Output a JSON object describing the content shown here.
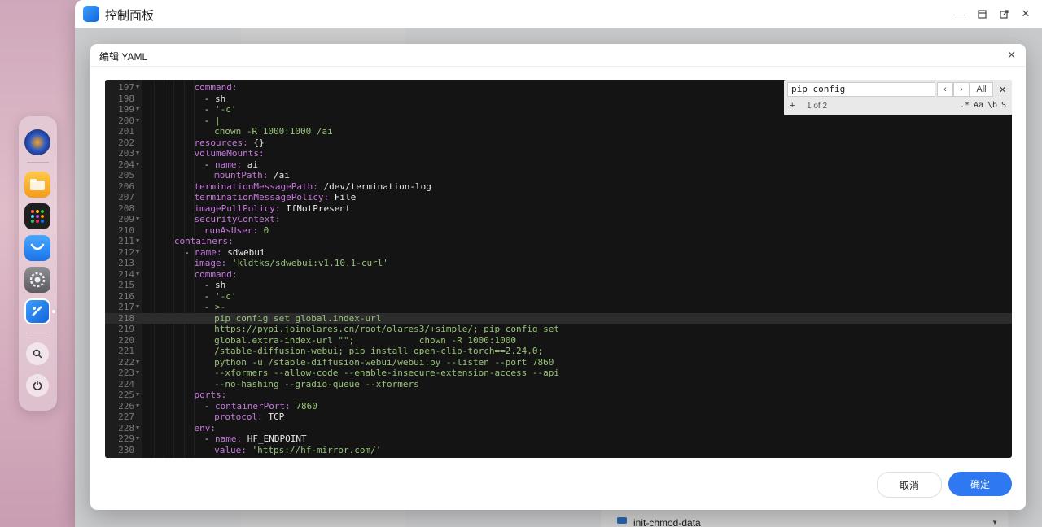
{
  "window": {
    "title": "控制面板"
  },
  "background": {
    "bottom_item": "init-chmod-data"
  },
  "dialog": {
    "title": "编辑 YAML",
    "cancel_label": "取消",
    "ok_label": "确定"
  },
  "search": {
    "query": "pip config",
    "all_label": "All",
    "count": "1 of 2",
    "prev": "‹",
    "next": "›",
    "close": "✕",
    "plus": "+",
    "opt_regex": ".*",
    "opt_case": "Aa",
    "opt_word": "\\b",
    "opt_selection": "S"
  },
  "editor": {
    "lines": [
      {
        "n": "197",
        "fold": true,
        "indent": 5,
        "parts": [
          [
            "k",
            "command"
          ],
          [
            "k",
            ":"
          ]
        ]
      },
      {
        "n": "198",
        "fold": false,
        "indent": 6,
        "parts": [
          [
            "n",
            "- "
          ],
          [
            "n",
            "sh"
          ]
        ]
      },
      {
        "n": "199",
        "fold": true,
        "indent": 6,
        "parts": [
          [
            "n",
            "- "
          ],
          [
            "s",
            "'-c'"
          ]
        ]
      },
      {
        "n": "200",
        "fold": true,
        "indent": 6,
        "parts": [
          [
            "n",
            "- "
          ],
          [
            "s",
            "|"
          ]
        ]
      },
      {
        "n": "201",
        "fold": false,
        "indent": 7,
        "parts": [
          [
            "s",
            "chown -R 1000:1000 /ai"
          ]
        ]
      },
      {
        "n": "202",
        "fold": false,
        "indent": 5,
        "parts": [
          [
            "k",
            "resources"
          ],
          [
            "k",
            ": "
          ],
          [
            "n",
            "{}"
          ]
        ]
      },
      {
        "n": "203",
        "fold": true,
        "indent": 5,
        "parts": [
          [
            "k",
            "volumeMounts"
          ],
          [
            "k",
            ":"
          ]
        ]
      },
      {
        "n": "204",
        "fold": true,
        "indent": 6,
        "parts": [
          [
            "n",
            "- "
          ],
          [
            "k",
            "name"
          ],
          [
            "k",
            ": "
          ],
          [
            "n",
            "ai"
          ]
        ]
      },
      {
        "n": "205",
        "fold": false,
        "indent": 7,
        "parts": [
          [
            "k",
            "mountPath"
          ],
          [
            "k",
            ": "
          ],
          [
            "n",
            "/ai"
          ]
        ]
      },
      {
        "n": "206",
        "fold": false,
        "indent": 5,
        "parts": [
          [
            "k",
            "terminationMessagePath"
          ],
          [
            "k",
            ": "
          ],
          [
            "n",
            "/dev/termination-log"
          ]
        ]
      },
      {
        "n": "207",
        "fold": false,
        "indent": 5,
        "parts": [
          [
            "k",
            "terminationMessagePolicy"
          ],
          [
            "k",
            ": "
          ],
          [
            "n",
            "File"
          ]
        ]
      },
      {
        "n": "208",
        "fold": false,
        "indent": 5,
        "parts": [
          [
            "k",
            "imagePullPolicy"
          ],
          [
            "k",
            ": "
          ],
          [
            "n",
            "IfNotPresent"
          ]
        ]
      },
      {
        "n": "209",
        "fold": true,
        "indent": 5,
        "parts": [
          [
            "k",
            "securityContext"
          ],
          [
            "k",
            ":"
          ]
        ]
      },
      {
        "n": "210",
        "fold": false,
        "indent": 6,
        "parts": [
          [
            "k",
            "runAsUser"
          ],
          [
            "k",
            ": "
          ],
          [
            "s",
            "0"
          ]
        ]
      },
      {
        "n": "211",
        "fold": true,
        "indent": 3,
        "parts": [
          [
            "k",
            "containers"
          ],
          [
            "k",
            ":"
          ]
        ]
      },
      {
        "n": "212",
        "fold": true,
        "indent": 4,
        "parts": [
          [
            "n",
            "- "
          ],
          [
            "k",
            "name"
          ],
          [
            "k",
            ": "
          ],
          [
            "n",
            "sdwebui"
          ]
        ]
      },
      {
        "n": "213",
        "fold": false,
        "indent": 5,
        "parts": [
          [
            "k",
            "image"
          ],
          [
            "k",
            ": "
          ],
          [
            "s",
            "'kldtks/sdwebui:v1.10.1-curl'"
          ]
        ]
      },
      {
        "n": "214",
        "fold": true,
        "indent": 5,
        "parts": [
          [
            "k",
            "command"
          ],
          [
            "k",
            ":"
          ]
        ]
      },
      {
        "n": "215",
        "fold": false,
        "indent": 6,
        "parts": [
          [
            "n",
            "- "
          ],
          [
            "n",
            "sh"
          ]
        ]
      },
      {
        "n": "216",
        "fold": false,
        "indent": 6,
        "parts": [
          [
            "n",
            "- "
          ],
          [
            "s",
            "'-c'"
          ]
        ]
      },
      {
        "n": "217",
        "fold": true,
        "indent": 6,
        "parts": [
          [
            "n",
            "- "
          ],
          [
            "s",
            ">-"
          ]
        ]
      },
      {
        "n": "218",
        "fold": false,
        "indent": 7,
        "active": true,
        "parts": [
          [
            "s",
            "pip config"
          ],
          [
            "s",
            " set global.index-url"
          ]
        ]
      },
      {
        "n": "219",
        "fold": false,
        "indent": 7,
        "parts": [
          [
            "s",
            "https://pypi.joinolares.cn/root/olares3/+simple/; pip config set"
          ]
        ]
      },
      {
        "n": "220",
        "fold": false,
        "indent": 7,
        "parts": [
          [
            "s",
            "global.extra-index-url \"\";            chown -R 1000:1000"
          ]
        ]
      },
      {
        "n": "221",
        "fold": false,
        "indent": 7,
        "parts": [
          [
            "s",
            "/stable-diffusion-webui; pip install open-clip-torch==2.24.0;"
          ]
        ]
      },
      {
        "n": "222",
        "fold": true,
        "indent": 7,
        "parts": [
          [
            "s",
            "python -u /stable-diffusion-webui/webui.py --listen --port 7860"
          ]
        ]
      },
      {
        "n": "223",
        "fold": true,
        "indent": 7,
        "parts": [
          [
            "s",
            "--xformers --allow-code --enable-insecure-extension-access --api"
          ]
        ]
      },
      {
        "n": "224",
        "fold": false,
        "indent": 7,
        "parts": [
          [
            "s",
            "--no-hashing --gradio-queue --xformers"
          ]
        ]
      },
      {
        "n": "225",
        "fold": true,
        "indent": 5,
        "parts": [
          [
            "k",
            "ports"
          ],
          [
            "k",
            ":"
          ]
        ]
      },
      {
        "n": "226",
        "fold": true,
        "indent": 6,
        "parts": [
          [
            "n",
            "- "
          ],
          [
            "k",
            "containerPort"
          ],
          [
            "k",
            ": "
          ],
          [
            "s",
            "7860"
          ]
        ]
      },
      {
        "n": "227",
        "fold": false,
        "indent": 7,
        "parts": [
          [
            "k",
            "protocol"
          ],
          [
            "k",
            ": "
          ],
          [
            "n",
            "TCP"
          ]
        ]
      },
      {
        "n": "228",
        "fold": true,
        "indent": 5,
        "parts": [
          [
            "k",
            "env"
          ],
          [
            "k",
            ":"
          ]
        ]
      },
      {
        "n": "229",
        "fold": true,
        "indent": 6,
        "parts": [
          [
            "n",
            "- "
          ],
          [
            "k",
            "name"
          ],
          [
            "k",
            ": "
          ],
          [
            "n",
            "HF_ENDPOINT"
          ]
        ]
      },
      {
        "n": "230",
        "fold": false,
        "indent": 7,
        "parts": [
          [
            "k",
            "value"
          ],
          [
            "k",
            ": "
          ],
          [
            "s",
            "'https://hf-mirror.com/'"
          ]
        ]
      }
    ]
  }
}
